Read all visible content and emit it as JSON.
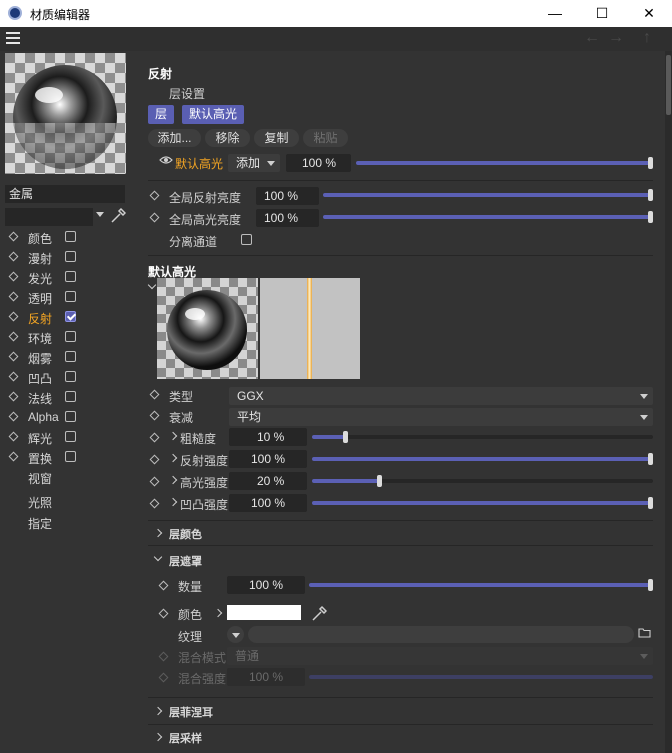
{
  "window": {
    "title": "材质编辑器",
    "minimize": "—",
    "maximize": "☐",
    "close": "✕"
  },
  "toolbar": {
    "menu_icon": "hamburger-icon",
    "back_icon": "arrow-left-icon",
    "forward_icon": "arrow-right-icon",
    "up_icon": "arrow-up-icon"
  },
  "material": {
    "name": "金属",
    "channels": [
      {
        "label": "颜色",
        "checked": false,
        "active": false
      },
      {
        "label": "漫射",
        "checked": false,
        "active": false
      },
      {
        "label": "发光",
        "checked": false,
        "active": false
      },
      {
        "label": "透明",
        "checked": false,
        "active": false
      },
      {
        "label": "反射",
        "checked": true,
        "active": true
      },
      {
        "label": "环境",
        "checked": false,
        "active": false
      },
      {
        "label": "烟雾",
        "checked": false,
        "active": false
      },
      {
        "label": "凹凸",
        "checked": false,
        "active": false
      },
      {
        "label": "法线",
        "checked": false,
        "active": false
      },
      {
        "label": "Alpha",
        "checked": false,
        "active": false
      },
      {
        "label": "辉光",
        "checked": false,
        "active": false
      },
      {
        "label": "置换",
        "checked": false,
        "active": false
      }
    ],
    "extras": [
      "视窗",
      "光照",
      "指定"
    ]
  },
  "reflection": {
    "title": "反射",
    "layer_settings": "层设置",
    "tabs": [
      "层",
      "默认高光"
    ],
    "buttons": {
      "add": "添加...",
      "remove": "移除",
      "copy": "复制",
      "paste": "粘贴"
    },
    "layer": {
      "name": "默认高光",
      "mode": "添加",
      "value": "100 %",
      "fraction": 1.0
    },
    "global_reflection": {
      "label": "全局反射亮度",
      "value": "100 %",
      "fraction": 1.0
    },
    "global_specular": {
      "label": "全局高光亮度",
      "value": "100 %",
      "fraction": 1.0
    },
    "separate_pass": {
      "label": "分离通道",
      "checked": false
    }
  },
  "default_specular": {
    "title": "默认高光",
    "type": {
      "label": "类型",
      "value": "GGX"
    },
    "attenuation": {
      "label": "衰减",
      "value": "平均"
    },
    "roughness": {
      "label": "粗糙度",
      "value": "10 %",
      "fraction": 0.1
    },
    "reflection_strength": {
      "label": "反射强度",
      "value": "100 %",
      "fraction": 1.0
    },
    "specular_strength": {
      "label": "高光强度",
      "value": "20 %",
      "fraction": 0.2
    },
    "bump_strength": {
      "label": "凹凸强度",
      "value": "100 %",
      "fraction": 1.0
    }
  },
  "layer_color": {
    "title": "层颜色"
  },
  "layer_mask": {
    "title": "层遮罩",
    "amount": {
      "label": "数量",
      "value": "100 %",
      "fraction": 1.0
    },
    "color": {
      "label": "颜色",
      "swatch": "#ffffff"
    },
    "texture": {
      "label": "纹理"
    },
    "blend_mode": {
      "label": "混合模式",
      "value": "普通"
    },
    "blend_strength": {
      "label": "混合强度",
      "value": "100 %",
      "fraction": 1.0
    }
  },
  "layer_fresnel": {
    "title": "层菲涅耳"
  },
  "layer_sampling": {
    "title": "层采样"
  },
  "colors": {
    "accent": "#5b60b5",
    "active_text": "#f5a623",
    "background": "#333333",
    "field": "#262626"
  }
}
